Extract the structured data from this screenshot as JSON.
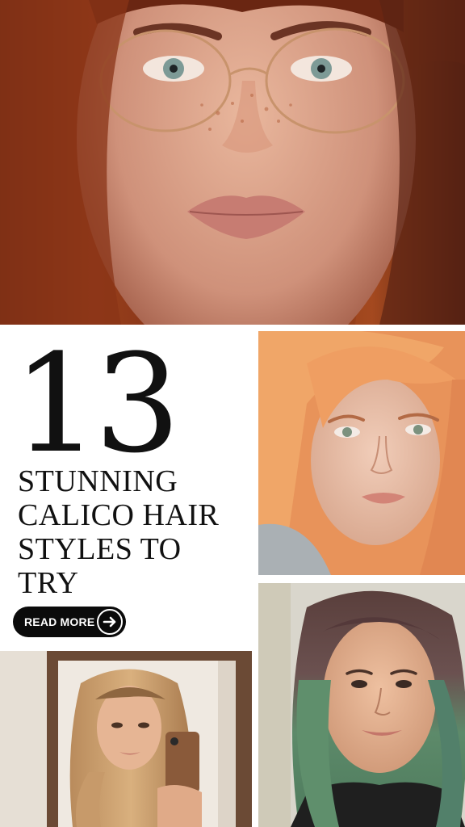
{
  "pin": {
    "number": "13",
    "headline_lines": [
      "STUNNING",
      "CALICO HAIR",
      "STYLES TO",
      "TRY"
    ],
    "cta_label": "READ MORE"
  },
  "photos": [
    {
      "subject": "close-up of woman with copper red hair, freckles and round gold glasses"
    },
    {
      "subject": "woman with strawberry orange blonde hair and freckles"
    },
    {
      "subject": "woman with long dark hair with sage green ends, smiling"
    },
    {
      "subject": "mirror selfie of woman with long honey blonde wavy hair holding phone"
    }
  ],
  "colors": {
    "text": "#111111",
    "button_bg": "#0b0b0b",
    "button_text": "#ffffff",
    "background": "#ffffff"
  },
  "icons": {
    "cta_icon": "arrow-right-circle-icon"
  }
}
